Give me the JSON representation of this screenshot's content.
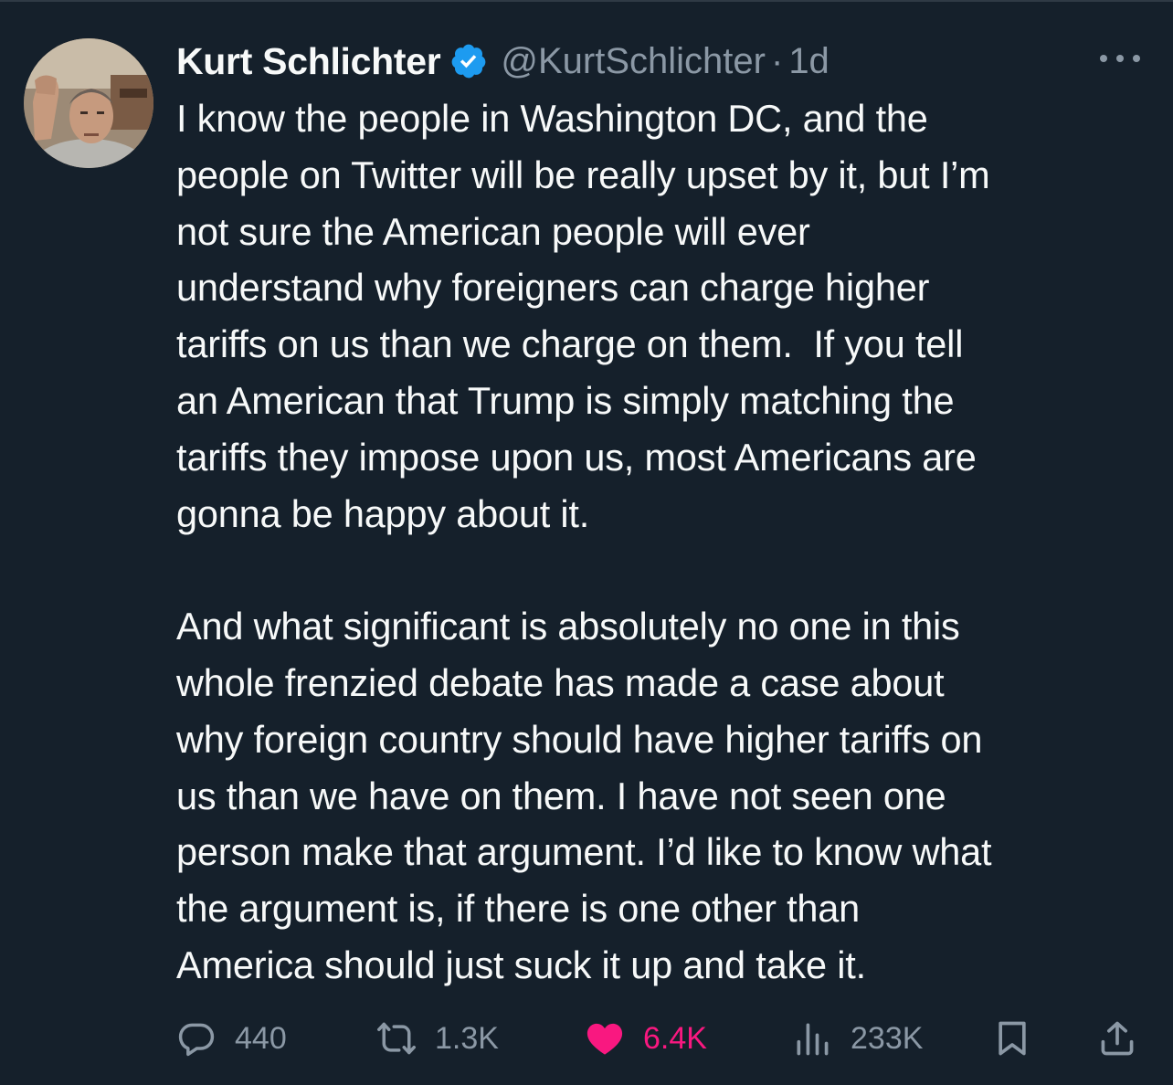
{
  "author": {
    "display_name": "Kurt Schlichter",
    "verified": true,
    "handle": "@KurtSchlichter",
    "separator": "·",
    "time": "1d"
  },
  "tweet": {
    "paragraphs": [
      {
        "lines": [
          "I know the people in Washington DC, and the",
          "people on Twitter will be really upset by it, but I’m",
          "not sure the American people will ever",
          "understand why foreigners can charge higher",
          "tariffs on us than we charge on them.  If you tell",
          "an American that Trump is simply matching the",
          "tariffs they impose upon us, most Americans are",
          "gonna be happy about it."
        ]
      },
      {
        "lines": [
          "And what significant is absolutely no one in this",
          "whole frenzied debate has made a case about",
          "why foreign country should have higher tariffs on",
          "us than we have on them. I have not seen one",
          "person make that argument. I’d like to know what",
          "the argument is, if there is one other than",
          "America should just suck it up and take it."
        ]
      }
    ]
  },
  "actions": {
    "replies": {
      "icon": "reply-icon",
      "count": "440"
    },
    "reposts": {
      "icon": "repost-icon",
      "count": "1.3K"
    },
    "likes": {
      "icon": "heart-icon",
      "count": "6.4K",
      "liked": true
    },
    "views": {
      "icon": "views-icon",
      "count": "233K"
    },
    "bookmark": {
      "icon": "bookmark-icon"
    },
    "share": {
      "icon": "share-icon"
    }
  },
  "colors": {
    "background": "#15202b",
    "text": "#f7f9f9",
    "secondary": "#8b98a5",
    "verified": "#1d9bf0",
    "like": "#f91880"
  }
}
